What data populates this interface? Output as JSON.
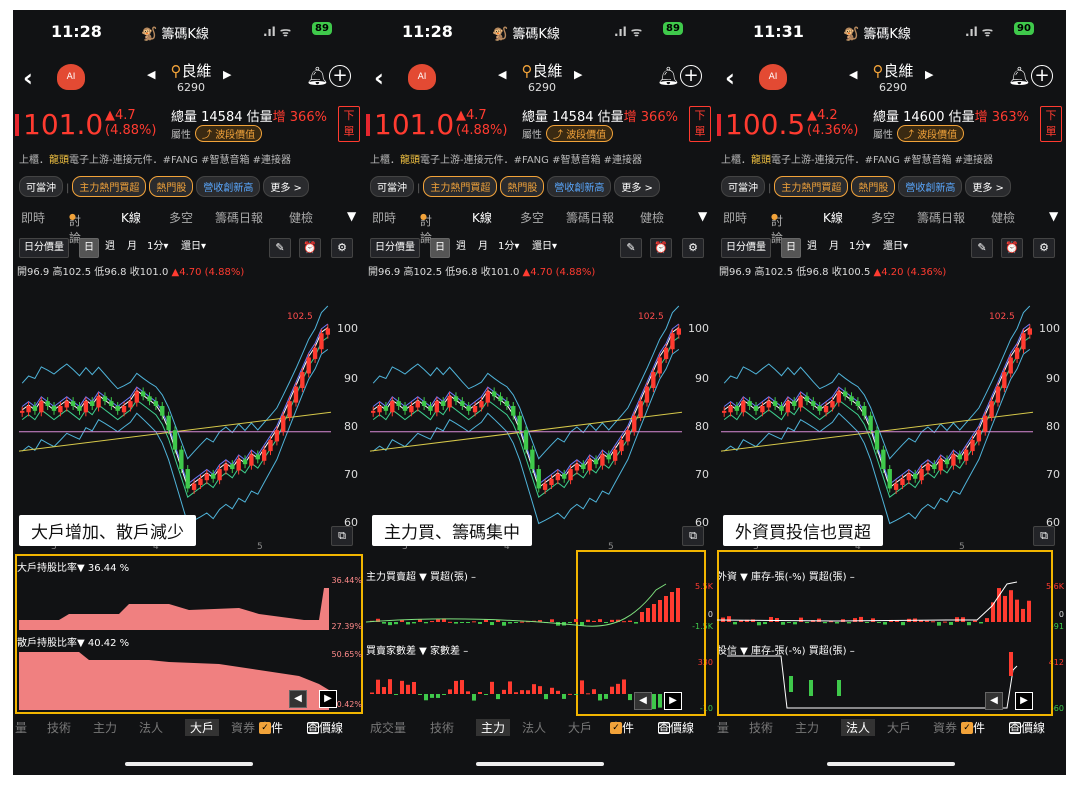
{
  "status": {
    "times": [
      "11:28",
      "11:28",
      "11:31"
    ],
    "battery": [
      "89",
      "89",
      "90"
    ],
    "app_title": "籌碼K線"
  },
  "stock": {
    "name": "良維",
    "code": "6290",
    "attr_label": "屬性",
    "attr_pill": "波段價值",
    "order_label": "下單",
    "tags_market": "上櫃．",
    "tags_highlight": "龍頭",
    "tags_rest": "電子上游-連接元件．#FANG #智慧音箱 #連接器"
  },
  "quotes": [
    {
      "price": "101.0",
      "change": "▲4.7",
      "pct": "(4.88%)",
      "vol": "總量 14584 估量",
      "vol_tag": "增",
      "vol_pct": "366%"
    },
    {
      "price": "101.0",
      "change": "▲4.7",
      "pct": "(4.88%)",
      "vol": "總量 14584 估量",
      "vol_tag": "增",
      "vol_pct": "366%"
    },
    {
      "price": "100.5",
      "change": "▲4.2",
      "pct": "(4.36%)",
      "vol": "總量 14600 估量",
      "vol_tag": "增",
      "vol_pct": "363%"
    }
  ],
  "chips": [
    "可當沖",
    "主力熱門買超",
    "熱門股",
    "營收創新高",
    "更多 >"
  ],
  "tabs": [
    "即時",
    "討論",
    "K線",
    "多空",
    "籌碼日報",
    "健檢"
  ],
  "tools": {
    "buttons": [
      "日分價量",
      "日",
      "週",
      "月",
      "1分▾",
      "還日▾"
    ]
  },
  "ohlc": [
    {
      "text": "開96.9 高102.5 低96.8 收101.0",
      "chg": "▲4.70 (4.88%)"
    },
    {
      "text": "開96.9 高102.5 低96.8 收101.0",
      "chg": "▲4.70 (4.88%)"
    },
    {
      "text": "開96.9 高102.5 低96.8 收100.5",
      "chg": "▲4.20 (4.36%)"
    }
  ],
  "chart": {
    "high_label": "102.5",
    "yticks": [
      "100",
      "90",
      "80",
      "70",
      "60"
    ],
    "xlabels": [
      "3",
      "4",
      "5"
    ]
  },
  "overlays": [
    "大戶增加、散戶減少",
    "主力買、籌碼集中",
    "外資買投信也買超"
  ],
  "sub1": {
    "a_label": "大戶持股比率▼",
    "a_val": "36.44 %",
    "a_top": "36.44%",
    "a_bot": "27.39%",
    "b_label": "散戶持股比率▼",
    "b_val": "40.42 %",
    "b_top": "50.65%",
    "b_bot": "40.42%"
  },
  "sub2": {
    "a_label": "主力買賣超",
    "a_dd": "▼",
    "a_sub": "買超(張) –",
    "a_top": "5.5K",
    "a_mid": "0",
    "a_bot": "-1.5K",
    "b_label": "買賣家數差",
    "b_dd": "▼",
    "b_sub": "家數差 –",
    "b_top": "330",
    "b_bot": "-10"
  },
  "sub3": {
    "a_label": "外資",
    "a_dd": "▼",
    "a_sub": "庫存-張(-%)  買超(張) –",
    "a_top": "5.6K",
    "a_mid": "0",
    "a_bot": "-91",
    "b_label": "投信",
    "b_dd": "▼",
    "b_sub": "庫存-張(-%)  買超(張) –",
    "b_top": "412",
    "b_bot": "-60"
  },
  "bottom_tabs": [
    [
      "量",
      "技術",
      "主力",
      "法人",
      "大戶",
      "資券"
    ],
    [
      "成交量",
      "技術",
      "主力",
      "法人",
      "大戶"
    ],
    [
      "量",
      "技術",
      "主力",
      "法人",
      "大戶",
      "資券"
    ]
  ],
  "bottom_active": [
    "大戶",
    "主力",
    "法人"
  ],
  "checks": {
    "event": "事件",
    "price_line": "查價線"
  },
  "colors": {
    "up": "#ff3b30",
    "down": "#3fc94b",
    "accent": "#f2a33a",
    "box": "#f2b500"
  }
}
